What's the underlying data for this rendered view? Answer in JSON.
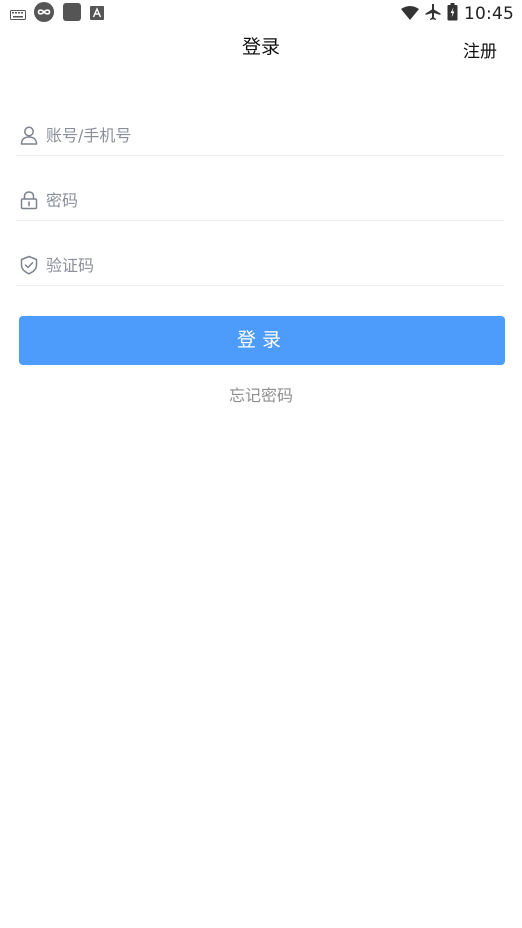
{
  "status_bar": {
    "time": "10:45",
    "left_icons": [
      "keyboard-icon",
      "infinity-app-icon",
      "square-app-icon",
      "a-app-icon"
    ],
    "right_icons": [
      "wifi-icon",
      "airplane-icon",
      "battery-icon"
    ]
  },
  "header": {
    "title": "登录",
    "register_label": "注册"
  },
  "form": {
    "account_placeholder": "账号/手机号",
    "password_placeholder": "密码",
    "code_placeholder": "验证码"
  },
  "actions": {
    "login_label": "登录",
    "forgot_label": "忘记密码"
  },
  "colors": {
    "primary": "#4d9cfc",
    "divider": "#ececec",
    "placeholder": "#8a8f99",
    "link_gray": "#8f8f8f"
  }
}
